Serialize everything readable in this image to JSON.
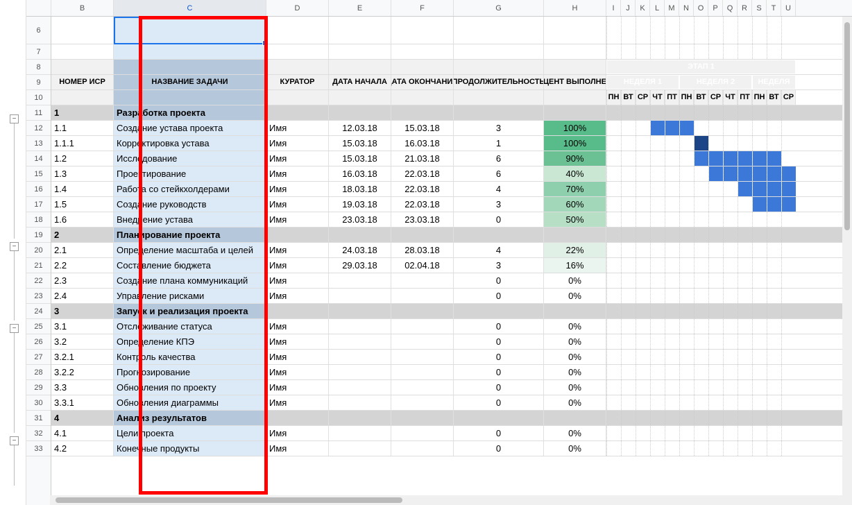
{
  "columns": [
    "B",
    "C",
    "D",
    "E",
    "F",
    "G",
    "H",
    "I",
    "J",
    "K",
    "L",
    "M",
    "N",
    "O",
    "P",
    "Q",
    "R",
    "S",
    "T",
    "U"
  ],
  "selected_col": "C",
  "row_start": 6,
  "headers": {
    "wbs": "НОМЕР ИСР",
    "task": "НАЗВАНИЕ ЗАДАЧИ",
    "owner": "КУРАТОР",
    "start": "ДАТА НАЧАЛА",
    "end": "ДАТА ОКОНЧАНИЯ",
    "duration": "ПРОДОЛЖИТЕЛЬНОСТЬ",
    "pct": "ПРОЦЕНТ ВЫПОЛНЕНИЯ"
  },
  "phase_label": "ЭТАП 1",
  "weeks": [
    "НЕДЕЛЯ 1",
    "НЕДЕЛЯ 2",
    "НЕДЕЛЯ"
  ],
  "days": [
    "ПН",
    "ВТ",
    "СР",
    "ЧТ",
    "ПТ",
    "ПН",
    "ВТ",
    "СР",
    "ЧТ",
    "ПТ",
    "ПН",
    "ВТ",
    "СР"
  ],
  "chart_data": {
    "type": "table",
    "rows": [
      {
        "rn": 11,
        "section": true,
        "wbs": "1",
        "task": "Разработка проекта"
      },
      {
        "rn": 12,
        "wbs": "1.1",
        "task": "Создание устава проекта",
        "owner": "Имя",
        "start": "12.03.18",
        "end": "15.03.18",
        "dur": "3",
        "pct": "100%",
        "pclass": "pct100",
        "gantt": [
          0,
          0,
          0,
          1,
          1,
          1,
          0,
          0,
          0,
          0,
          0,
          0,
          0
        ]
      },
      {
        "rn": 13,
        "wbs": "1.1.1",
        "task": "Корректировка устава",
        "owner": "Имя",
        "start": "15.03.18",
        "end": "16.03.18",
        "dur": "1",
        "pct": "100%",
        "pclass": "pct100",
        "gantt": [
          0,
          0,
          0,
          0,
          0,
          0,
          2,
          0,
          0,
          0,
          0,
          0,
          0
        ]
      },
      {
        "rn": 14,
        "wbs": "1.2",
        "task": "Исследование",
        "owner": "Имя",
        "start": "15.03.18",
        "end": "21.03.18",
        "dur": "6",
        "pct": "90%",
        "pclass": "pct90",
        "gantt": [
          0,
          0,
          0,
          0,
          0,
          0,
          1,
          1,
          1,
          1,
          1,
          1,
          0
        ]
      },
      {
        "rn": 15,
        "wbs": "1.3",
        "task": "Проектирование",
        "owner": "Имя",
        "start": "16.03.18",
        "end": "22.03.18",
        "dur": "6",
        "pct": "40%",
        "pclass": "pct40",
        "gantt": [
          0,
          0,
          0,
          0,
          0,
          0,
          0,
          1,
          1,
          1,
          1,
          1,
          1
        ]
      },
      {
        "rn": 16,
        "wbs": "1.4",
        "task": "Работа со стейкхолдерами",
        "owner": "Имя",
        "start": "18.03.18",
        "end": "22.03.18",
        "dur": "4",
        "pct": "70%",
        "pclass": "pct70",
        "gantt": [
          0,
          0,
          0,
          0,
          0,
          0,
          0,
          0,
          0,
          1,
          1,
          1,
          1
        ]
      },
      {
        "rn": 17,
        "wbs": "1.5",
        "task": "Создание руководств",
        "owner": "Имя",
        "start": "19.03.18",
        "end": "22.03.18",
        "dur": "3",
        "pct": "60%",
        "pclass": "pct60",
        "gantt": [
          0,
          0,
          0,
          0,
          0,
          0,
          0,
          0,
          0,
          0,
          1,
          1,
          1
        ]
      },
      {
        "rn": 18,
        "wbs": "1.6",
        "task": "Внедрение устава",
        "owner": "Имя",
        "start": "23.03.18",
        "end": "23.03.18",
        "dur": "0",
        "pct": "50%",
        "pclass": "pct50",
        "gantt": [
          0,
          0,
          0,
          0,
          0,
          0,
          0,
          0,
          0,
          0,
          0,
          0,
          0
        ]
      },
      {
        "rn": 19,
        "section": true,
        "wbs": "2",
        "task": "Планирование проекта"
      },
      {
        "rn": 20,
        "wbs": "2.1",
        "task": "Определение масштаба и целей",
        "owner": "Имя",
        "start": "24.03.18",
        "end": "28.03.18",
        "dur": "4",
        "pct": "22%",
        "pclass": "pct22",
        "gantt": [
          0,
          0,
          0,
          0,
          0,
          0,
          0,
          0,
          0,
          0,
          0,
          0,
          0
        ]
      },
      {
        "rn": 21,
        "wbs": "2.2",
        "task": "Составление бюджета",
        "owner": "Имя",
        "start": "29.03.18",
        "end": "02.04.18",
        "dur": "3",
        "pct": "16%",
        "pclass": "pct16",
        "gantt": [
          0,
          0,
          0,
          0,
          0,
          0,
          0,
          0,
          0,
          0,
          0,
          0,
          0
        ]
      },
      {
        "rn": 22,
        "wbs": "2.3",
        "task": "Создание плана коммуникаций",
        "owner": "Имя",
        "start": "",
        "end": "",
        "dur": "0",
        "pct": "0%",
        "pclass": "pct0",
        "gantt": [
          0,
          0,
          0,
          0,
          0,
          0,
          0,
          0,
          0,
          0,
          0,
          0,
          0
        ]
      },
      {
        "rn": 23,
        "wbs": "2.4",
        "task": "Управление рисками",
        "owner": "Имя",
        "start": "",
        "end": "",
        "dur": "0",
        "pct": "0%",
        "pclass": "pct0",
        "gantt": [
          0,
          0,
          0,
          0,
          0,
          0,
          0,
          0,
          0,
          0,
          0,
          0,
          0
        ]
      },
      {
        "rn": 24,
        "section": true,
        "wbs": "3",
        "task": "Запуск и реализация проекта"
      },
      {
        "rn": 25,
        "wbs": "3.1",
        "task": "Отслеживание статуса",
        "owner": "Имя",
        "start": "",
        "end": "",
        "dur": "0",
        "pct": "0%",
        "pclass": "pct0",
        "gantt": [
          0,
          0,
          0,
          0,
          0,
          0,
          0,
          0,
          0,
          0,
          0,
          0,
          0
        ]
      },
      {
        "rn": 26,
        "wbs": "3.2",
        "task": "Определение КПЭ",
        "owner": "Имя",
        "start": "",
        "end": "",
        "dur": "0",
        "pct": "0%",
        "pclass": "pct0",
        "gantt": [
          0,
          0,
          0,
          0,
          0,
          0,
          0,
          0,
          0,
          0,
          0,
          0,
          0
        ]
      },
      {
        "rn": 27,
        "wbs": "3.2.1",
        "task": "Контроль качества",
        "owner": "Имя",
        "start": "",
        "end": "",
        "dur": "0",
        "pct": "0%",
        "pclass": "pct0",
        "gantt": [
          0,
          0,
          0,
          0,
          0,
          0,
          0,
          0,
          0,
          0,
          0,
          0,
          0
        ]
      },
      {
        "rn": 28,
        "wbs": "3.2.2",
        "task": "Прогнозирование",
        "owner": "Имя",
        "start": "",
        "end": "",
        "dur": "0",
        "pct": "0%",
        "pclass": "pct0",
        "gantt": [
          0,
          0,
          0,
          0,
          0,
          0,
          0,
          0,
          0,
          0,
          0,
          0,
          0
        ]
      },
      {
        "rn": 29,
        "wbs": "3.3",
        "task": "Обновления по проекту",
        "owner": "Имя",
        "start": "",
        "end": "",
        "dur": "0",
        "pct": "0%",
        "pclass": "pct0",
        "gantt": [
          0,
          0,
          0,
          0,
          0,
          0,
          0,
          0,
          0,
          0,
          0,
          0,
          0
        ]
      },
      {
        "rn": 30,
        "wbs": "3.3.1",
        "task": "Обновления диаграммы",
        "owner": "Имя",
        "start": "",
        "end": "",
        "dur": "0",
        "pct": "0%",
        "pclass": "pct0",
        "gantt": [
          0,
          0,
          0,
          0,
          0,
          0,
          0,
          0,
          0,
          0,
          0,
          0,
          0
        ]
      },
      {
        "rn": 31,
        "section": true,
        "wbs": "4",
        "task": "Анализ результатов"
      },
      {
        "rn": 32,
        "wbs": "4.1",
        "task": "Цели проекта",
        "owner": "Имя",
        "start": "",
        "end": "",
        "dur": "0",
        "pct": "0%",
        "pclass": "pct0",
        "gantt": [
          0,
          0,
          0,
          0,
          0,
          0,
          0,
          0,
          0,
          0,
          0,
          0,
          0
        ]
      },
      {
        "rn": 33,
        "wbs": "4.2",
        "task": "Конечные продукты",
        "owner": "Имя",
        "start": "",
        "end": "",
        "dur": "0",
        "pct": "0%",
        "pclass": "pct0",
        "gantt": [
          0,
          0,
          0,
          0,
          0,
          0,
          0,
          0,
          0,
          0,
          0,
          0,
          0
        ]
      }
    ]
  }
}
